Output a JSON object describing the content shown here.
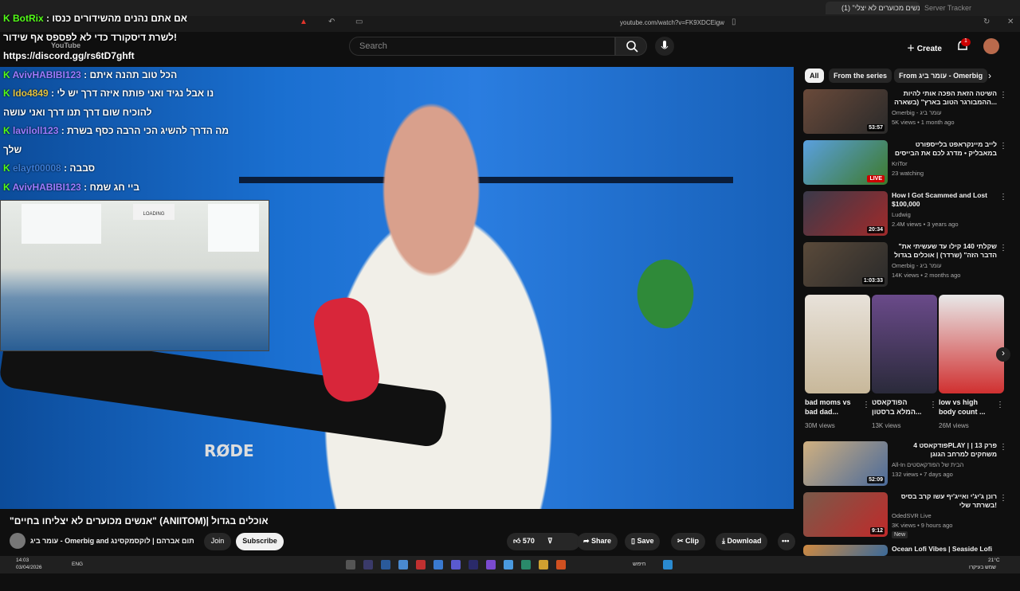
{
  "browser": {
    "tab_title": "(1) \"אנשים מכוערים לא יצלי...",
    "tab2_title": "Server Tracker",
    "url": "youtube.com/watch?v=FK9XDCEigw"
  },
  "header": {
    "logo": "YouTube",
    "search_placeholder": "Search",
    "create_label": "Create",
    "notif_count": "1"
  },
  "chat": [
    {
      "user": "BotRix",
      "sep": " : ",
      "msg": "אם אתם נהנים מהשידורים כנסו",
      "ucolor": "#53fc18"
    },
    {
      "user": "",
      "sep": "",
      "msg": "לשרת דיסקורד כדי לא לפספס אף שידור!",
      "ucolor": "#fff"
    },
    {
      "user": "",
      "sep": "",
      "msg": "https://discord.gg/rs6tD7ghft",
      "ucolor": "#fff"
    },
    {
      "user": "AvivHABIBI123",
      "sep": " : ",
      "msg": "הכל טוב תהנה איתם",
      "ucolor": "#9d7bff"
    },
    {
      "user": "Ido4849",
      "sep": " : ",
      "msg": "נו אבל נגיד ואני פותח איזה דרך יש לי",
      "ucolor": "#e0c040"
    },
    {
      "user": "",
      "sep": "",
      "msg": "להוכיח שום דרך תנו דרך ואני עושה",
      "ucolor": "#fff"
    },
    {
      "user": "laviloll123",
      "sep": " : ",
      "msg": "מה הדרך להשיג הכי הרבה כסף בשרת",
      "ucolor": "#9d7bff"
    },
    {
      "user": "",
      "sep": "",
      "msg": "שלך",
      "ucolor": "#fff"
    },
    {
      "user": "elayt00008",
      "sep": " : ",
      "msg": "סבבה",
      "ucolor": "#3a7bd5"
    },
    {
      "user": "AvivHABIBI123",
      "sep": " : ",
      "msg": "ביי חג שמח",
      "ucolor": "#9d7bff"
    }
  ],
  "video": {
    "title": "\"אנשים מכוערים לא יצליחו בחיים\" (ANIITOM)| אוכלים בגדול",
    "channel": "עומר ביג - Omerbig and תום אברהם | לוקסמקסינג",
    "join_label": "Join",
    "subscribe_label": "Subscribe",
    "likes": "570",
    "share_label": "Share",
    "save_label": "Save",
    "clip_label": "Clip",
    "download_label": "Download",
    "mic_brand": "RØDE",
    "cam_sign": "LOADING"
  },
  "chips": [
    {
      "label": "All",
      "active": true
    },
    {
      "label": "From the series",
      "active": false
    },
    {
      "label": "From עומר ביג - Omerbig",
      "active": false
    }
  ],
  "recs": [
    {
      "title": "השיטה הזאת הפכה אותי להיות ההמבורגר הטוב בארץ\" (בשארה...",
      "channel": "Omerbig - עומר ביג",
      "meta": "5K views • 1 month ago",
      "badge": "53:57",
      "live": false,
      "ltr": false,
      "c1": "#6a4a3a",
      "c2": "#2a2a2a"
    },
    {
      "title": "לייב מיינקראפט בלייספורט במאבליק • מדרג לכם את הבייסים 🔴",
      "channel": "KriTor",
      "meta": "23 watching",
      "badge": "LIVE",
      "live": true,
      "ltr": false,
      "c1": "#5aa0e0",
      "c2": "#3d7a2a"
    },
    {
      "title": "How I Got Scammed and Lost $100,000",
      "channel": "Ludwig",
      "meta": "2.4M views • 3 years ago",
      "badge": "20:34",
      "live": false,
      "ltr": true,
      "c1": "#3a3a4a",
      "c2": "#a02a2a"
    },
    {
      "title": "\"שקלתי 140 קילו עד שעשיתי את הדבר הזה\" (שרדר) | אוכלים בגדול",
      "channel": "Omerbig - עומר ביג",
      "meta": "14K views • 2 months ago",
      "badge": "1:03:33",
      "live": false,
      "ltr": false,
      "c1": "#5a4a3a",
      "c2": "#2a2a2a"
    },
    {
      "title": "פודקאסט 4PLAY | פרק 13 | משחקים למרחב הגוגן",
      "channel": "All-In הבית של הפודקאסטים",
      "meta": "132 views • 7 days ago",
      "badge": "52:09",
      "live": false,
      "ltr": false,
      "c1": "#d0b080",
      "c2": "#4a6a9a"
    },
    {
      "title": "רונן ג'יג'י ואייג'יף עשו קרב בסיס בשרתר שלי!",
      "channel": "OdedSVR Live",
      "meta": "3K views • 9 hours ago",
      "badge": "9:12",
      "live": false,
      "ltr": false,
      "c1": "#7a5a4a",
      "c2": "#c02a2a"
    },
    {
      "title": "Ocean Lofi Vibes | Seaside Lofi",
      "channel": "",
      "meta": "",
      "badge": "",
      "live": false,
      "ltr": true,
      "c1": "#d08a40",
      "c2": "#3a6a9a"
    }
  ],
  "rec_new_label": "New",
  "shorts": [
    {
      "title": "bad moms vs bad dad...",
      "views": "30M views",
      "c1": "#e8e2da",
      "c2": "#c8b89a"
    },
    {
      "title": "הפודקאסט המלא ברסטון...",
      "views": "13K views",
      "c1": "#6a4a8a",
      "c2": "#2a2a3a"
    },
    {
      "title": "low vs high body count ...",
      "views": "26M views",
      "c1": "#e8e8e8",
      "c2": "#d03030"
    }
  ],
  "taskbar": {
    "time": "14:03",
    "date": "03/04/2026",
    "lang": "ENG",
    "weather": "21°C",
    "weather_desc": "שמש בעיקרו",
    "search_label": "חיפוש"
  }
}
